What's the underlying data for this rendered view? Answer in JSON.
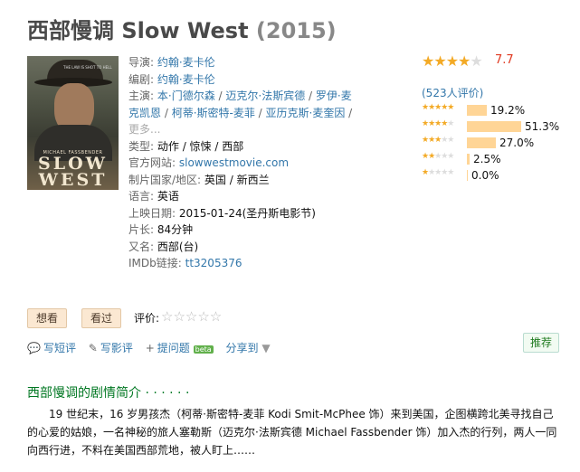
{
  "movie": {
    "title_cn": "西部慢调",
    "title_en": "Slow West",
    "year": "(2015)"
  },
  "poster": {
    "tagline": "THE LAW IS SHOT TO HELL",
    "actor_name": "MICHAEL FASSBENDER",
    "title_line1": "SLOW",
    "title_line2": "WEST"
  },
  "info": {
    "director_label": "导演:",
    "director": "约翰·麦卡伦",
    "writer_label": "编剧:",
    "writer": "约翰·麦卡伦",
    "cast_label": "主演:",
    "cast": [
      "本·门德尔森",
      "迈克尔·法斯宾德",
      "罗伊·麦克凯恩",
      "柯蒂·斯密特-麦菲",
      "亚历克斯·麦奎因"
    ],
    "more": "更多...",
    "genre_label": "类型:",
    "genre": "动作 / 惊悚 / 西部",
    "website_label": "官方网站:",
    "website": "slowwestmovie.com",
    "country_label": "制片国家/地区:",
    "country": "英国 / 新西兰",
    "language_label": "语言:",
    "language": "英语",
    "release_label": "上映日期:",
    "release": "2015-01-24(圣丹斯电影节)",
    "runtime_label": "片长:",
    "runtime": "84分钟",
    "aka_label": "又名:",
    "aka": "西部(台)",
    "imdb_label": "IMDb链接:",
    "imdb": "tt3205376"
  },
  "rating": {
    "score": "7.7",
    "votes": "(523人评价)",
    "stars": 4,
    "distribution": [
      {
        "stars": 5,
        "percent": "19.2%",
        "value": 19.2
      },
      {
        "stars": 4,
        "percent": "51.3%",
        "value": 51.3
      },
      {
        "stars": 3,
        "percent": "27.0%",
        "value": 27.0
      },
      {
        "stars": 2,
        "percent": "2.5%",
        "value": 2.5
      },
      {
        "stars": 1,
        "percent": "0.0%",
        "value": 0.0
      }
    ]
  },
  "buttons": {
    "want": "想看",
    "seen": "看过",
    "rate_label": "评价:",
    "recommend": "推荐"
  },
  "actions": {
    "short_review": "写短评",
    "review": "写影评",
    "ask": "提问题",
    "beta": "beta",
    "share": "分享到"
  },
  "summary": {
    "heading": "西部慢调的剧情简介 · · · · · ·",
    "text": "19 世纪末，16 岁男孩杰（柯蒂·斯密特-麦菲 Kodi Smit-McPhee 饰）来到美国，企图横跨北美寻找自己的心爱的姑娘，一名神秘的旅人塞勒斯（迈克尔·法斯宾德 Michael Fassbender 饰）加入杰的行列，两人一同向西行进，不料在美国西部荒地，被人盯上……"
  },
  "colors": {
    "link": "#3377aa",
    "star": "#f3aa26",
    "score": "#e0381f",
    "bar": "#ffd596",
    "green": "#007722"
  }
}
